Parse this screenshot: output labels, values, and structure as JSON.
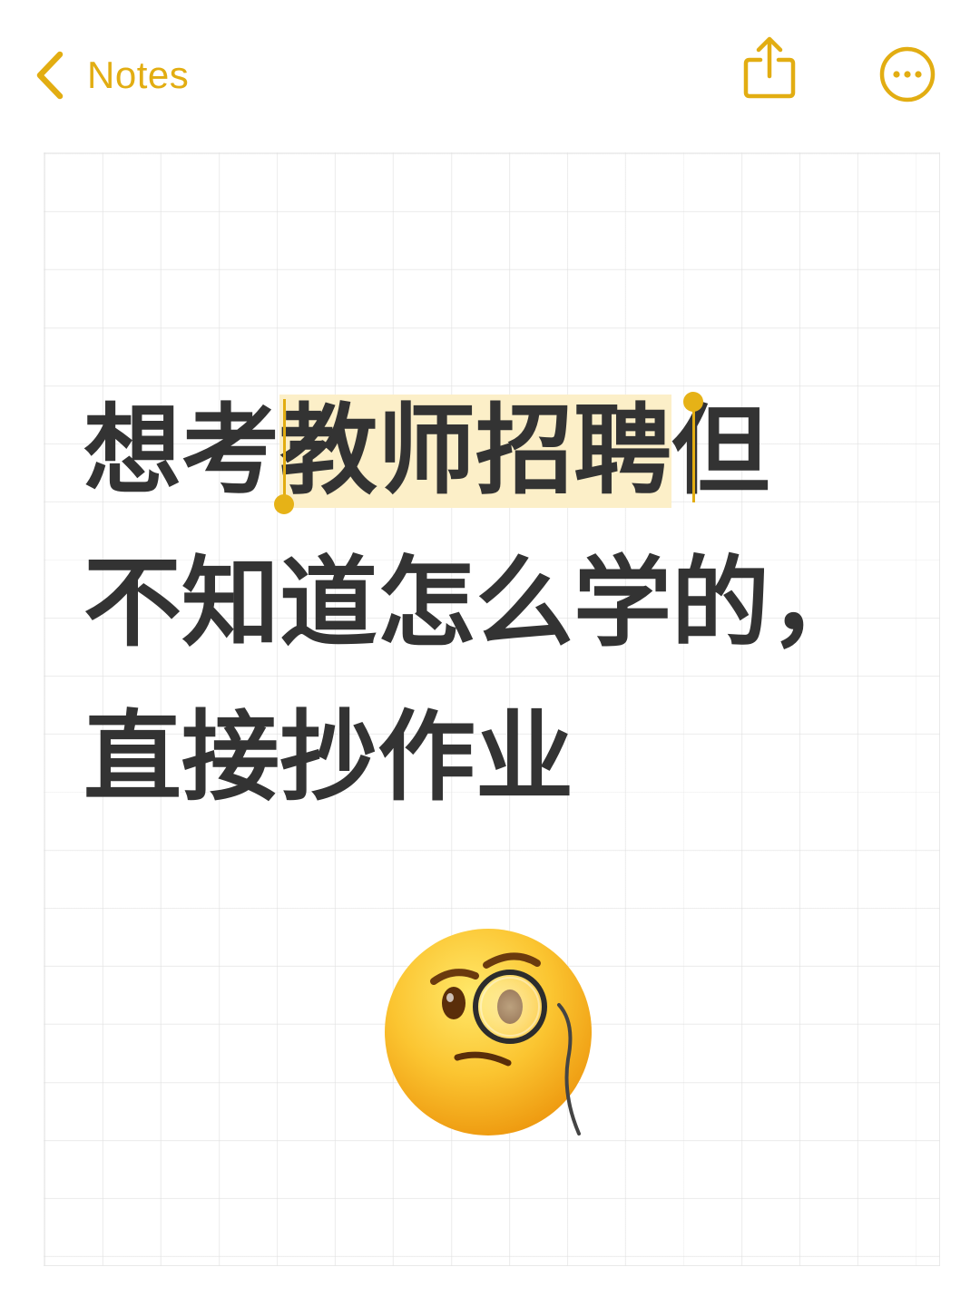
{
  "nav": {
    "back_label": "Notes",
    "back_icon": "chevron-left-icon",
    "share_icon": "share-icon",
    "more_icon": "ellipsis-circle-icon"
  },
  "note": {
    "line1_before": "想考",
    "line1_selected": "教师招聘",
    "line1_after": "但",
    "line2": "不知道怎么学的，",
    "line3": "直接抄作业",
    "emoji": "face-with-monocle-emoji"
  },
  "colors": {
    "accent": "#E2AD12",
    "selection": "#FCEFC8",
    "text": "#333333"
  }
}
